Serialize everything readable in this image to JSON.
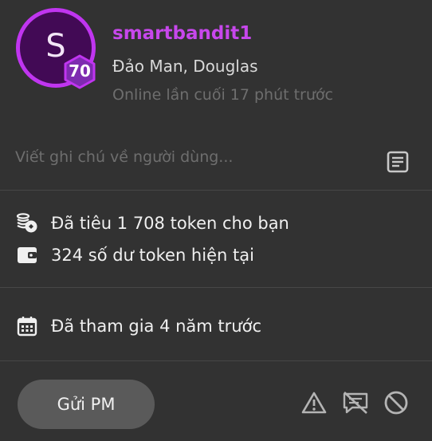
{
  "profile": {
    "avatar_letter": "S",
    "level": "70",
    "username": "smartbandit1",
    "real_name": "Đảo Man, Douglas",
    "last_seen": "Online lần cuối 17 phút trước"
  },
  "note": {
    "placeholder": "Viết ghi chú về người dùng...",
    "value": "",
    "icon": "note-icon"
  },
  "stats": {
    "tokens_spent": "Đã tiêu 1 708 token cho bạn",
    "token_balance": "324 số dư token hiện tại"
  },
  "membership": {
    "joined": "Đã tham gia 4 năm trước"
  },
  "actions": {
    "pm_label": "Gửi PM",
    "icons": [
      "report-icon",
      "hide-messages-icon",
      "block-icon"
    ]
  },
  "colors": {
    "background": "#323232",
    "accent": "#c035f0",
    "username": "#c747ec",
    "muted_text": "#6e6e6e",
    "button": "#5a5a5a"
  }
}
